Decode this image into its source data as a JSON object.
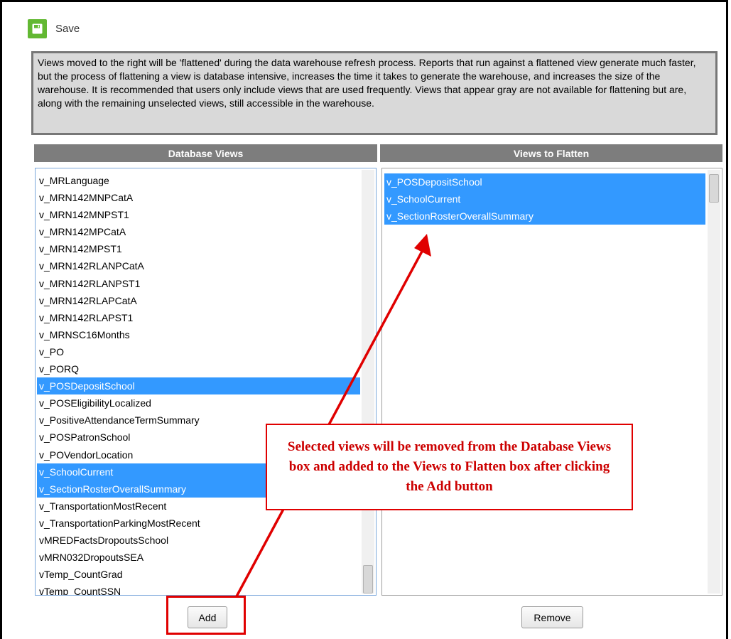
{
  "toolbar": {
    "save_label": "Save",
    "save_icon": "floppy-disk-icon",
    "save_icon_color": "#62b832"
  },
  "info": {
    "text": "Views moved to the right will be 'flattened' during the data warehouse refresh process. Reports that run against a flattened view generate much faster, but the process of flattening a view is database intensive, increases the time it takes to generate the warehouse, and increases the size of the warehouse. It is recommended that users only include views that are used frequently. Views that appear gray are not available for flattening but are, along with the remaining unselected views, still accessible in the warehouse."
  },
  "database_views": {
    "header": "Database Views",
    "items": [
      {
        "label": "v_MRLanguage",
        "selected": false
      },
      {
        "label": "v_MRN142MNPCatA",
        "selected": false
      },
      {
        "label": "v_MRN142MNPST1",
        "selected": false
      },
      {
        "label": "v_MRN142MPCatA",
        "selected": false
      },
      {
        "label": "v_MRN142MPST1",
        "selected": false
      },
      {
        "label": "v_MRN142RLANPCatA",
        "selected": false
      },
      {
        "label": "v_MRN142RLANPST1",
        "selected": false
      },
      {
        "label": "v_MRN142RLAPCatA",
        "selected": false
      },
      {
        "label": "v_MRN142RLAPST1",
        "selected": false
      },
      {
        "label": "v_MRNSC16Months",
        "selected": false
      },
      {
        "label": "v_PO",
        "selected": false
      },
      {
        "label": "v_PORQ",
        "selected": false
      },
      {
        "label": "v_POSDepositSchool",
        "selected": true
      },
      {
        "label": "v_POSEligibilityLocalized",
        "selected": false
      },
      {
        "label": "v_PositiveAttendanceTermSummary",
        "selected": false
      },
      {
        "label": "v_POSPatronSchool",
        "selected": false
      },
      {
        "label": "v_POVendorLocation",
        "selected": false
      },
      {
        "label": "v_SchoolCurrent",
        "selected": true
      },
      {
        "label": "v_SectionRosterOverallSummary",
        "selected": true
      },
      {
        "label": "v_TransportationMostRecent",
        "selected": false
      },
      {
        "label": "v_TransportationParkingMostRecent",
        "selected": false
      },
      {
        "label": "vMREDFactsDropoutsSchool",
        "selected": false
      },
      {
        "label": "vMRN032DropoutsSEA",
        "selected": false
      },
      {
        "label": "vTemp_CountGrad",
        "selected": false
      },
      {
        "label": "vTemp_CountSSN",
        "selected": false
      }
    ]
  },
  "views_to_flatten": {
    "header": "Views to Flatten",
    "items": [
      {
        "label": "v_POSDepositSchool",
        "selected": true
      },
      {
        "label": "v_SchoolCurrent",
        "selected": true
      },
      {
        "label": "v_SectionRosterOverallSummary",
        "selected": true
      }
    ]
  },
  "buttons": {
    "add_label": "Add",
    "remove_label": "Remove"
  },
  "annotation": {
    "text": "Selected views will be removed from the Database Views box and added to the Views to Flatten box after clicking the Add button",
    "color": "#e00000"
  },
  "colors": {
    "selection": "#3399ff",
    "header_bg": "#7d7d7d",
    "info_bg": "#d9d9d9"
  }
}
